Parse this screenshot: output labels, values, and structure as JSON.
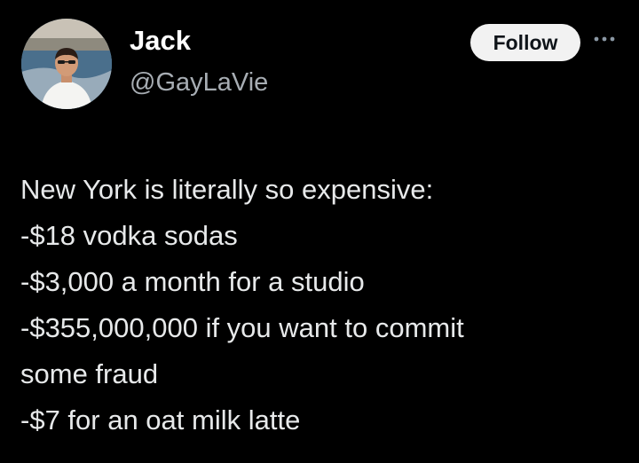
{
  "author": {
    "display_name": "Jack",
    "handle": "@GayLaVie"
  },
  "actions": {
    "follow_label": "Follow",
    "more_icon": "more-horizontal-icon"
  },
  "tweet": {
    "lines": [
      "New York is literally so expensive:",
      "-$18 vodka sodas",
      "-$3,000 a month for a studio",
      "-$355,000,000 if you want to commit",
      "some fraud",
      "-$7 for an oat milk latte"
    ]
  },
  "colors": {
    "background": "#000000",
    "text": "#e7e9ea",
    "handle": "#a7adb3",
    "follow_button_bg": "#f2f2f2",
    "follow_button_text": "#0f1419"
  }
}
